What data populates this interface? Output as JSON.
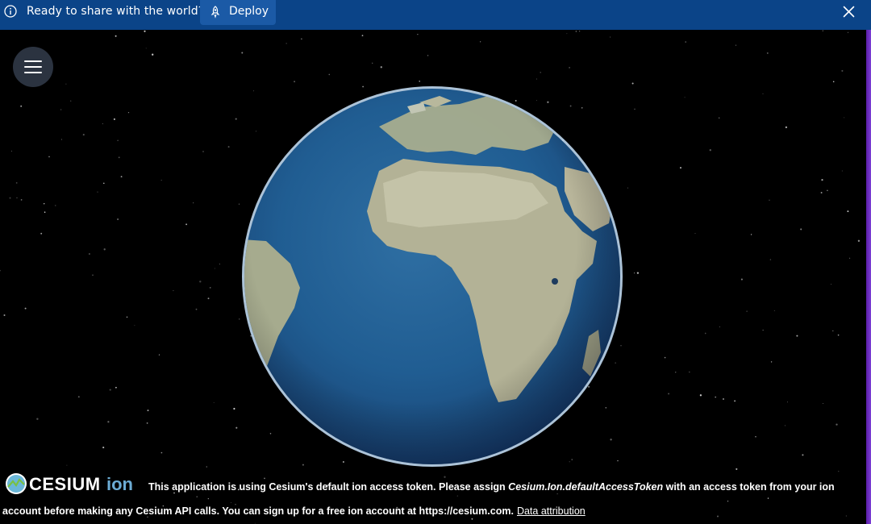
{
  "banner": {
    "icon": "info-icon",
    "message": "Ready to share with the world?",
    "deploy_label": "Deploy",
    "deploy_icon": "rocket-icon",
    "close_icon": "close-icon",
    "background": "#0b4488"
  },
  "viewer": {
    "menu_icon": "hamburger-menu-icon",
    "globe": "earth-globe"
  },
  "credits": {
    "logo": "cesium-ion-logo",
    "line1_a": "This application is using Cesium's default ion access token. Please assign ",
    "line1_token": "Cesium.Ion.defaultAccessToken",
    "line1_b": " with an access token from your ion",
    "line2": "account before making any Cesium API calls. You can sign up for a free ion account at https://cesium.com.",
    "data_attribution": "Data attribution"
  }
}
